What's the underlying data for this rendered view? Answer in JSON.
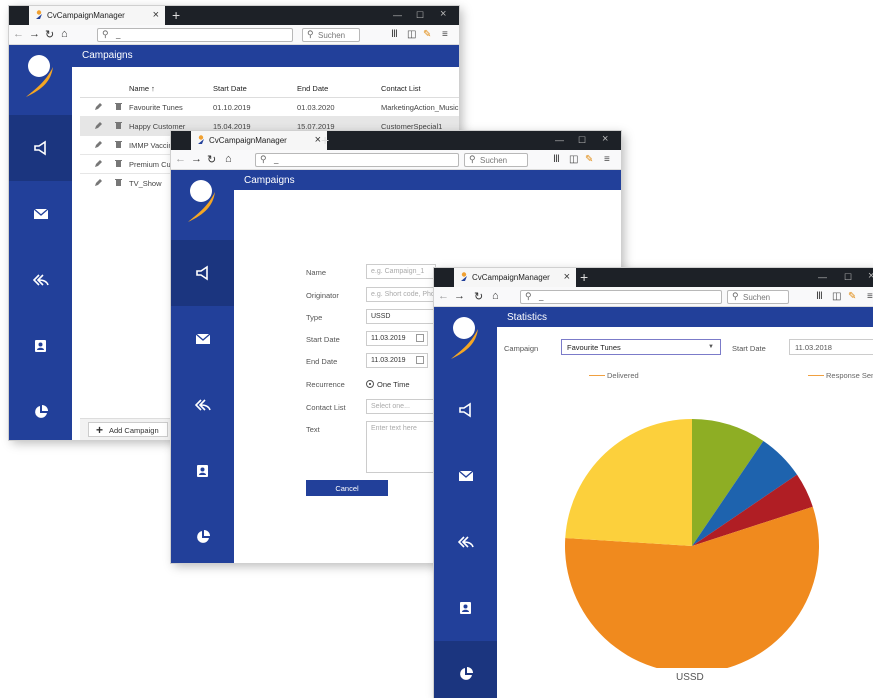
{
  "browser": {
    "tab_title": "CvCampaignManager",
    "address_value": "_",
    "search_placeholder": "Suchen"
  },
  "window1": {
    "header_title": "Campaigns",
    "columns": [
      "Name ↑",
      "Start Date",
      "End Date",
      "Contact List"
    ],
    "rows": [
      {
        "name": "Favourite Tunes",
        "start": "01.10.2019",
        "end": "01.03.2020",
        "contact": "MarketingAction_Music"
      },
      {
        "name": "Happy Customer",
        "start": "15.04.2019",
        "end": "15.07.2019",
        "contact": "CustomerSpecial1"
      },
      {
        "name": "IMMP Vaccin",
        "start": "",
        "end": "",
        "contact": ""
      },
      {
        "name": "Premium Cus",
        "start": "",
        "end": "",
        "contact": ""
      },
      {
        "name": "TV_Show",
        "start": "",
        "end": "",
        "contact": ""
      }
    ],
    "add_button": "Add Campaign"
  },
  "window2": {
    "header_title": "Campaigns",
    "labels": {
      "name": "Name",
      "originator": "Originator",
      "type": "Type",
      "start": "Start Date",
      "end": "End Date",
      "recurrence": "Recurrence",
      "contact": "Contact List",
      "text": "Text"
    },
    "name_placeholder": "e.g. Campaign_1",
    "originator_placeholder": "e.g. Short code, Phon",
    "type_value": "USSD",
    "start_value": "11.03.2019",
    "end_value": "11.03.2019",
    "recurrence_option": "One Time",
    "contact_placeholder": "Select one...",
    "text_placeholder": "Enter text here",
    "cancel_button": "Cancel"
  },
  "window3": {
    "header_title": "Statistics",
    "campaign_label": "Campaign",
    "campaign_value": "Favourite Tunes",
    "start_label": "Start Date",
    "start_value": "11.03.2018",
    "legend_delivered": "Delivered",
    "legend_response": "Response Sent",
    "pie_label": "USSD"
  },
  "colors": {
    "sidebar": "#22409a",
    "sidebar_active": "#1b357f",
    "accent_orange": "#f0a030"
  },
  "chart_data": {
    "type": "pie",
    "title": "USSD",
    "legend": [
      "Delivered",
      "Response Sent"
    ],
    "slices": [
      {
        "value": 9.5,
        "color": "#8eae24"
      },
      {
        "value": 6,
        "color": "#1e63ae"
      },
      {
        "value": 4.5,
        "color": "#b01e24"
      },
      {
        "value": 56,
        "color": "#f08a1e"
      },
      {
        "value": 24,
        "color": "#fcd03c"
      }
    ],
    "start_angle_deg": 0,
    "legend_position": "top"
  }
}
